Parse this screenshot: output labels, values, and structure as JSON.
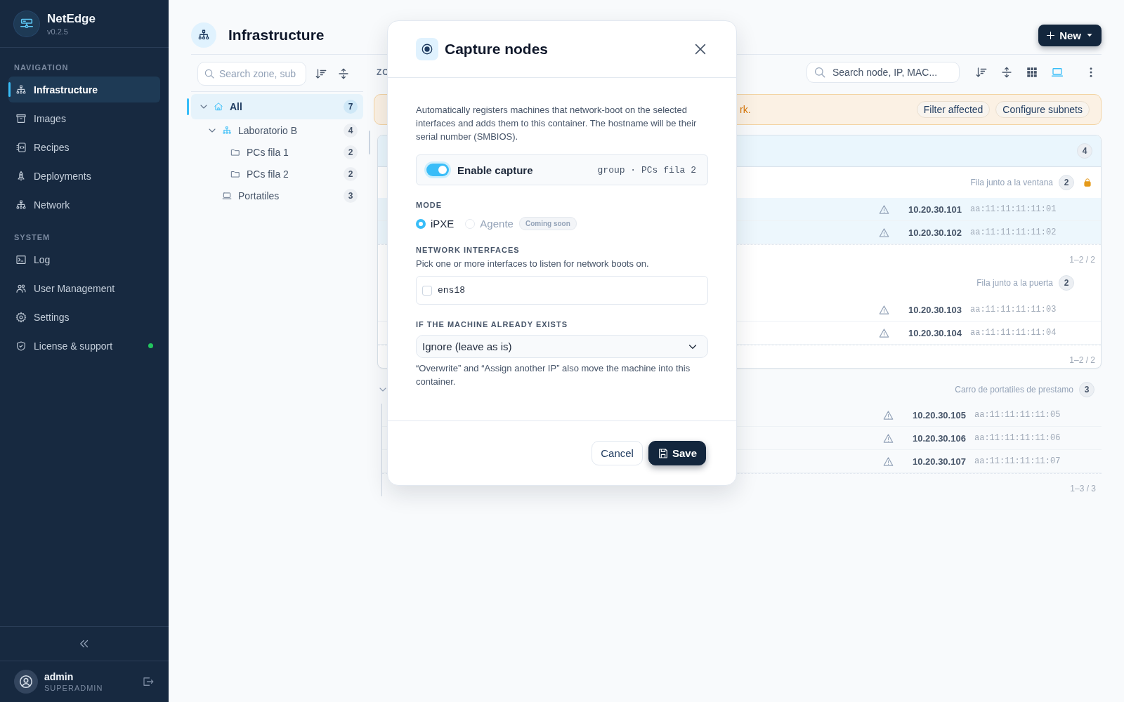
{
  "app": {
    "name": "NetEdge",
    "version": "v0.2.5"
  },
  "sidebar": {
    "sections": [
      {
        "title": "NAVIGATION",
        "items": [
          {
            "label": "Infrastructure",
            "selected": true
          },
          {
            "label": "Images",
            "selected": false
          },
          {
            "label": "Recipes",
            "selected": false
          },
          {
            "label": "Deployments",
            "selected": false
          },
          {
            "label": "Network",
            "selected": false
          }
        ]
      },
      {
        "title": "SYSTEM",
        "items": [
          {
            "label": "Log",
            "selected": false
          },
          {
            "label": "User Management",
            "selected": false
          },
          {
            "label": "Settings",
            "selected": false
          },
          {
            "label": "License & support",
            "selected": false,
            "color": "#22c55e"
          }
        ]
      }
    ]
  },
  "user": {
    "name": "admin",
    "role": "SUPERADMIN"
  },
  "page": {
    "title": "Infrastructure",
    "new_button": "New"
  },
  "tree": {
    "search_placeholder": "Search zone, sub",
    "nodes": [
      {
        "label": "All",
        "count": "7",
        "selected": true,
        "expanded": true,
        "children": [
          {
            "label": "Laboratorio B",
            "count": "4",
            "selected": false,
            "expanded": true,
            "children": [
              {
                "label": "PCs fila 1",
                "count": "2",
                "selected": false
              },
              {
                "label": "PCs fila 2",
                "count": "2",
                "selected": false
              }
            ]
          },
          {
            "label": "Portatiles",
            "count": "3",
            "selected": false
          }
        ]
      }
    ]
  },
  "content": {
    "column_1": "ZO",
    "search_placeholder": "Search node, IP, MAC...",
    "views": [
      {
        "selected": false
      },
      {
        "selected": true
      }
    ],
    "banner": {
      "text": "rk.",
      "actions": [
        "Filter affected",
        "Configure subnets"
      ]
    },
    "cards": [
      {
        "count": "4",
        "subgroups": [
          {
            "title": "Fila junto a la ventana",
            "count": "2",
            "locked": true,
            "range": "1–2 / 2",
            "rows": [
              {
                "ip": "10.20.30.101",
                "mac": "aa:11:11:11:11:01",
                "selected": true,
                "warning": true
              },
              {
                "ip": "10.20.30.102",
                "mac": "aa:11:11:11:11:02",
                "selected": true,
                "warning": true
              }
            ]
          },
          {
            "title": "Fila junto a la puerta",
            "count": "2",
            "locked": false,
            "range": "1–2 / 2",
            "rows": [
              {
                "ip": "10.20.30.103",
                "mac": "aa:11:11:11:11:03",
                "selected": false,
                "warning": true
              },
              {
                "ip": "10.20.30.104",
                "mac": "aa:11:11:11:11:04",
                "selected": false,
                "warning": true
              }
            ]
          }
        ]
      }
    ],
    "loose_groups": [
      {
        "title": "Carro de portatiles de prestamo",
        "count": "3",
        "expanded": true,
        "range": "1–3 / 3",
        "rows": [
          {
            "ip": "10.20.30.105",
            "mac": "aa:11:11:11:11:05",
            "selected": false,
            "warning": true
          },
          {
            "ip": "10.20.30.106",
            "mac": "aa:11:11:11:11:06",
            "selected": false,
            "warning": true
          },
          {
            "ip": "10.20.30.107",
            "mac": "aa:11:11:11:11:07",
            "selected": false,
            "warning": true
          }
        ]
      }
    ]
  },
  "modal": {
    "title": "Capture nodes",
    "description": "Automatically registers machines that network-boot on the selected interfaces and adds them to this container. The hostname will be their serial number (SMBIOS).",
    "capture": {
      "label": "Enable capture",
      "on": true,
      "target": "group · PCs fila 2"
    },
    "mode": {
      "label": "MODE",
      "options": [
        {
          "label": "iPXE",
          "selected": true,
          "disabled": false
        },
        {
          "label": "Agente",
          "selected": false,
          "disabled": true,
          "badge": "Coming soon"
        }
      ]
    },
    "interfaces": {
      "label": "NETWORK INTERFACES",
      "hint": "Pick one or more interfaces to listen for network boots on.",
      "items": [
        {
          "name": "ens18",
          "checked": false
        }
      ]
    },
    "existing": {
      "label": "IF THE MACHINE ALREADY EXISTS",
      "value": "Ignore (leave as is)",
      "help": "“Overwrite” and “Assign another IP” also move the machine into this container."
    },
    "buttons": [
      {
        "label": "Cancel",
        "kind": "secondary"
      },
      {
        "label": "Save",
        "kind": "primary"
      }
    ]
  }
}
